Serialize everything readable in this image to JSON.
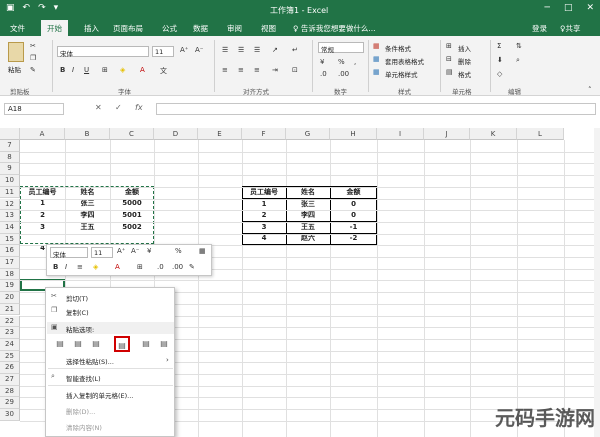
{
  "titlebar": {
    "title": "工作簿1 - Excel",
    "min": "─",
    "max": "□",
    "close": "✕",
    "save": "▣",
    "undo": "↶",
    "redo": "↷",
    "more": "▾"
  },
  "tabs": [
    "文件",
    "开始",
    "插入",
    "页面布局",
    "公式",
    "数据",
    "审阅",
    "视图"
  ],
  "tell_me": "♀ 告诉我您想要做什么...",
  "login": "登录",
  "share": "♀共享",
  "ribbon": {
    "paste": "粘贴",
    "clipboard": "剪贴板",
    "font_name": "宋体",
    "font_size": "11",
    "font_group": "字体",
    "align_group": "对齐方式",
    "number_format": "常规",
    "number_group": "数字",
    "cond_format": "条件格式",
    "table_format": "套用表格格式",
    "cell_style": "单元格样式",
    "style_group": "样式",
    "insert": "插入",
    "delete": "删除",
    "format": "格式",
    "cells_group": "单元格",
    "edit_group": "编辑"
  },
  "formula_bar": {
    "namebox": "A18",
    "cancel": "✕",
    "confirm": "✓",
    "fx": "fx"
  },
  "columns": [
    "A",
    "B",
    "C",
    "D",
    "E",
    "F",
    "G",
    "H",
    "I",
    "J",
    "K",
    "L"
  ],
  "rows": [
    "7",
    "8",
    "9",
    "10",
    "11",
    "12",
    "13",
    "14",
    "15",
    "16",
    "17",
    "18",
    "19",
    "20",
    "21",
    "22",
    "23",
    "24",
    "25",
    "26",
    "27",
    "28",
    "29",
    "30"
  ],
  "table1": {
    "headers": [
      "员工编号",
      "姓名",
      "金额"
    ],
    "rows": [
      [
        "1",
        "张三",
        "5000"
      ],
      [
        "2",
        "李四",
        "5001"
      ],
      [
        "3",
        "王五",
        "5002"
      ]
    ],
    "row15_a": "4"
  },
  "table2": {
    "headers": [
      "员工编号",
      "姓名",
      "金额"
    ],
    "rows": [
      [
        "1",
        "张三",
        "0"
      ],
      [
        "2",
        "李四",
        "0"
      ],
      [
        "3",
        "王五",
        "-1"
      ],
      [
        "4",
        "赵六",
        "-2"
      ]
    ]
  },
  "mini_toolbar": {
    "font": "宋体",
    "size": "11",
    "percent": "%"
  },
  "context_menu": {
    "cut": "剪切(T)",
    "copy": "复制(C)",
    "paste_options": "粘贴选项:",
    "paste_special": "选择性粘贴(S)...",
    "smart_lookup": "智能查找(L)",
    "insert_copied": "插入复制的单元格(E)...",
    "delete": "删除(D)...",
    "clear": "清除内容(N)"
  },
  "watermark": "元码手游网"
}
